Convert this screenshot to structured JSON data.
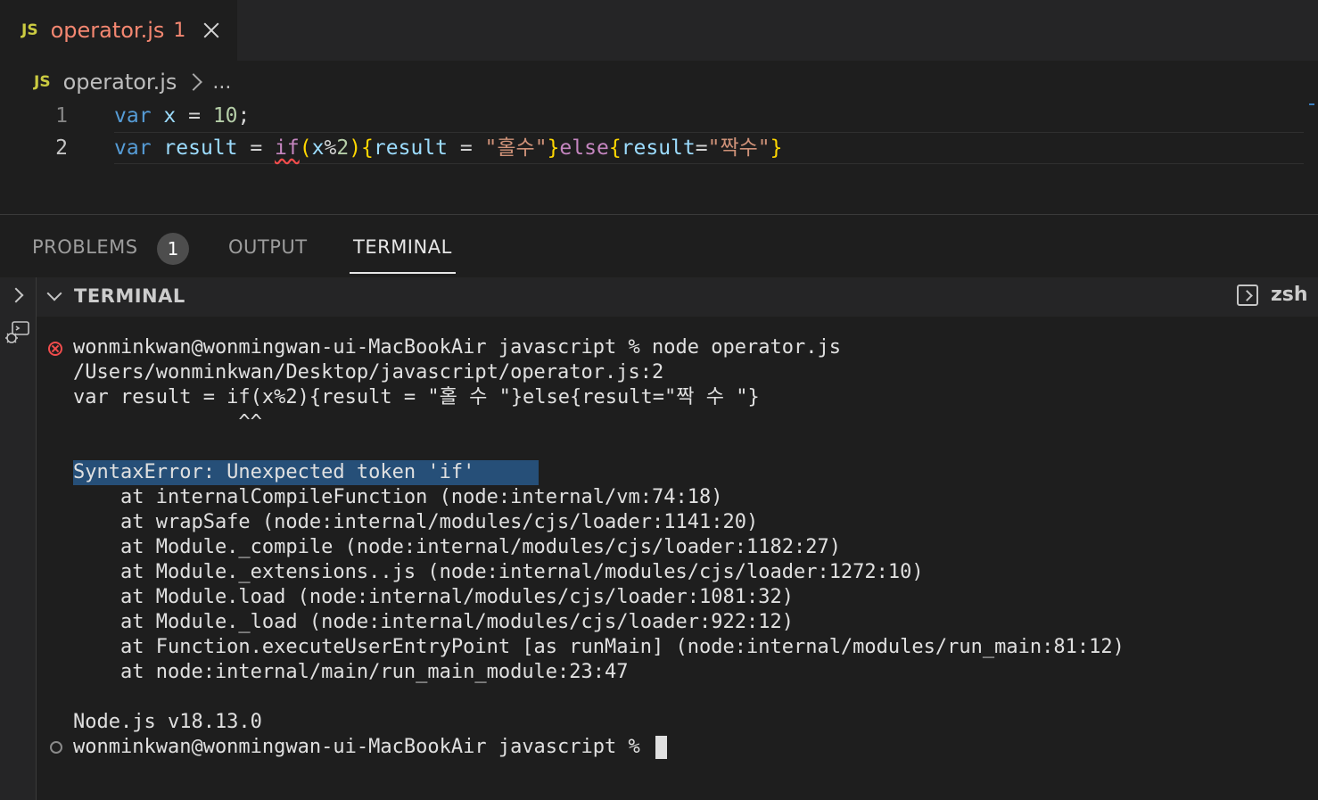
{
  "tab": {
    "icon_label": "JS",
    "filename": "operator.js",
    "problem_count": "1"
  },
  "breadcrumb": {
    "icon_label": "JS",
    "file": "operator.js",
    "more": "..."
  },
  "editor": {
    "lines": [
      {
        "number": "1"
      },
      {
        "number": "2"
      }
    ],
    "line1": {
      "t1": "var",
      "t2": " ",
      "t3": "x",
      "t4": " = ",
      "t5": "10",
      "t6": ";"
    },
    "line2": {
      "t1": "var",
      "t2": " ",
      "t3": "result",
      "t4": " = ",
      "t5": "if",
      "t6": "(",
      "t7": "x",
      "t8": "%",
      "t9": "2",
      "t10": ")",
      "t11": "{",
      "t12": "result",
      "t13": " = ",
      "t14": "\"홀수\"",
      "t15": "}",
      "t16": "else",
      "t17": "{",
      "t18": "result",
      "t19": "=",
      "t20": "\"짝수\"",
      "t21": "}"
    }
  },
  "panel": {
    "tabs": [
      {
        "label": "PROBLEMS",
        "badge": "1"
      },
      {
        "label": "OUTPUT"
      },
      {
        "label": "TERMINAL"
      }
    ],
    "terminal_header": {
      "title": "TERMINAL",
      "shell": "zsh"
    }
  },
  "terminal": {
    "lines": [
      "wonminkwan@wonmingwan-ui-MacBookAir javascript % node operator.js",
      "/Users/wonminkwan/Desktop/javascript/operator.js:2",
      "var result = if(x%2){result = \"홀 수 \"}else{result=\"짝 수 \"}",
      "              ^^",
      "",
      "SyntaxError: Unexpected token 'if'",
      "    at internalCompileFunction (node:internal/vm:74:18)",
      "    at wrapSafe (node:internal/modules/cjs/loader:1141:20)",
      "    at Module._compile (node:internal/modules/cjs/loader:1182:27)",
      "    at Module._extensions..js (node:internal/modules/cjs/loader:1272:10)",
      "    at Module.load (node:internal/modules/cjs/loader:1081:32)",
      "    at Module._load (node:internal/modules/cjs/loader:922:12)",
      "    at Function.executeUserEntryPoint [as runMain] (node:internal/modules/run_main:81:12)",
      "    at node:internal/main/run_main_module:23:47",
      "",
      "Node.js v18.13.0",
      "wonminkwan@wonmingwan-ui-MacBookAir javascript % "
    ]
  },
  "colors": {
    "error": "#f14c4c",
    "tab_error_text": "#f48771",
    "js_badge": "#cbcb41",
    "selection": "#264f78"
  }
}
